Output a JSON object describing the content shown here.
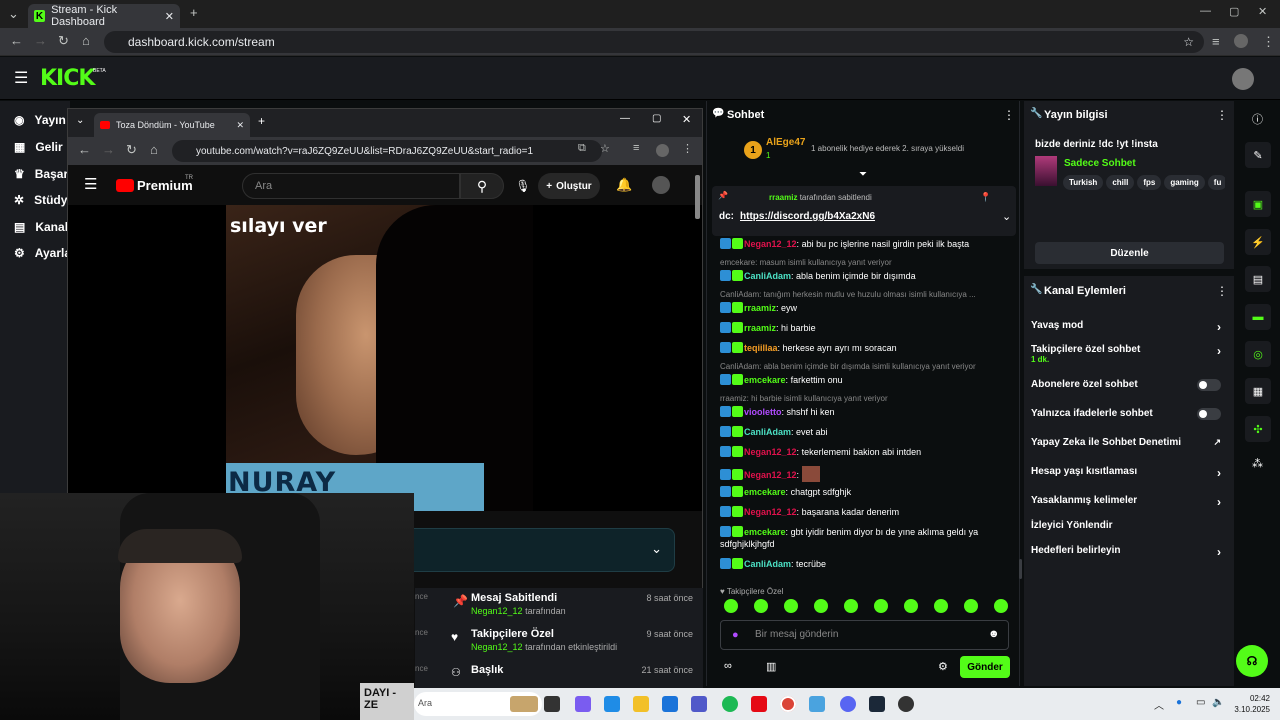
{
  "browser": {
    "tab_title": "Stream - Kick Dashboard",
    "url": "dashboard.kick.com/stream"
  },
  "kick": {
    "logo": "KICK",
    "beta": "BETA"
  },
  "left_nav": [
    "Yayın",
    "Gelir",
    "Başarı",
    "Stüdyo",
    "Kanal",
    "Ayarla"
  ],
  "youtube": {
    "tab_title": "Toza Döndüm - YouTube",
    "url": "youtube.com/watch?v=raJ6ZQ9ZeUU&list=RDraJ6ZQ9ZeUU&start_radio=1",
    "brand": "Premium",
    "brand_sup": "TR",
    "search_placeholder": "Ara",
    "create_label": "Oluştur",
    "poster_top": "sılayı ver",
    "poster_bottom": "NURAY HAFİFTAŞ"
  },
  "webcam": {
    "sign": "DAYI -ZE"
  },
  "activity": [
    {
      "title": "Mesaj Sabitlendi",
      "user": "Negan12_12",
      "suffix": "tarafından",
      "time": "8 saat önce",
      "icon": "pin-icon"
    },
    {
      "title": "Takipçilere Özel",
      "user": "Negan12_12",
      "suffix": "tarafından etkinleştirildi",
      "time": "9 saat önce",
      "icon": "heart-icon"
    },
    {
      "title": "Başlık",
      "time": "21 saat önce",
      "icon": "users-icon"
    }
  ],
  "activity_prefix": {
    "a": "nce",
    "b": "nce",
    "c": "nce"
  },
  "chat": {
    "title": "Sohbet",
    "top_gifter": {
      "name": "AlEge47",
      "count": "1",
      "rank": "1"
    },
    "gift_text": "1 abonelik hediye ederek 2. sıraya yükseldi",
    "pinned": {
      "user": "rraamiz",
      "by": "tarafından sabitlendi",
      "text": "dc:",
      "link": "https://discord.gg/b4Xa2xN6"
    },
    "messages": [
      {
        "reply": "",
        "user": "Negan12_12",
        "color": "nred",
        "text": "abi bu pc işlerine nasil girdin peki ilk başta"
      },
      {
        "reply": "emcekare: masum isimli kullanıcıya yanıt veriyor",
        "user": "CanliAdam",
        "color": "nteal",
        "text": "abla benim içimde bir dışımda"
      },
      {
        "reply": "CanliAdam: tanığım herkesin mutlu ve huzulu olması isimli kullanıcıya ...",
        "user": "rraamiz",
        "color": "ngreen",
        "text": "eyw"
      },
      {
        "reply": "",
        "user": "rraamiz",
        "color": "ngreen",
        "text": "hi barbie"
      },
      {
        "reply": "",
        "user": "teqiillaa",
        "color": "norange",
        "text": "herkese ayrı ayrı mı soracan"
      },
      {
        "reply": "CanliAdam: abla benim içimde bir dışımda isimli kullanıcıya yanıt veriyor",
        "user": "emcekare",
        "color": "ngreen",
        "text": "farkettim onu"
      },
      {
        "reply": "rraamiz: hi barbie isimli kullanıcıya yanıt veriyor",
        "user": "viooletto",
        "color": "npurple",
        "text": "shshf hi ken"
      },
      {
        "reply": "",
        "user": "CanliAdam",
        "color": "nteal",
        "text": "evet abi"
      },
      {
        "reply": "",
        "user": "Negan12_12",
        "color": "nred",
        "text": "tekerlememi bakion abi intden"
      },
      {
        "reply": "",
        "user": "Negan12_12",
        "color": "nred",
        "text": ""
      },
      {
        "reply": "",
        "user": "emcekare",
        "color": "ngreen",
        "text": "chatgpt sdfghjk"
      },
      {
        "reply": "",
        "user": "Negan12_12",
        "color": "nred",
        "text": "başarana kadar denerim"
      },
      {
        "reply": "",
        "user": "emcekare",
        "color": "ngreen",
        "text": "gbt iyidir benim diyor bı de yıne aklıma geldı ya sdfghjklkjhgfd"
      },
      {
        "reply": "",
        "user": "CanliAdam",
        "color": "nteal",
        "text": "tecrübe"
      }
    ],
    "followers_only": "Takipçilere Özel",
    "input_placeholder": "Bir mesaj gönderin",
    "send_label": "Gönder"
  },
  "stream_info": {
    "title": "Yayın bilgisi",
    "stream_title": "bizde deriniz !dc !yt !insta",
    "category": "Sadece Sohbet",
    "tags": [
      "Turkish",
      "chill",
      "fps",
      "gaming",
      "fu"
    ],
    "edit_label": "Düzenle"
  },
  "channel_actions": {
    "title": "Kanal Eylemleri",
    "items": [
      {
        "label": "Yavaş mod",
        "control": "arrow"
      },
      {
        "label": "Takipçilere özel sohbet",
        "sub": "1 dk.",
        "control": "arrow"
      },
      {
        "label": "Abonelere özel sohbet",
        "control": "toggle"
      },
      {
        "label": "Yalnızca ifadelerle sohbet",
        "control": "toggle"
      },
      {
        "label": "Yapay Zeka ile Sohbet Denetimi",
        "control": "external"
      },
      {
        "label": "Hesap yaşı kısıtlaması",
        "control": "arrow"
      },
      {
        "label": "Yasaklanmış kelimeler",
        "control": "arrow"
      },
      {
        "label": "İzleyici Yönlendir",
        "control": "none"
      },
      {
        "label": "Hedefleri belirleyin",
        "control": "arrow"
      }
    ]
  },
  "taskbar": {
    "search": "Ara",
    "time": "02:42",
    "date": "3.10.2025"
  },
  "colors": {
    "accent": "#53fc18",
    "panel": "#191b1f",
    "bg": "#0b0e0f"
  }
}
